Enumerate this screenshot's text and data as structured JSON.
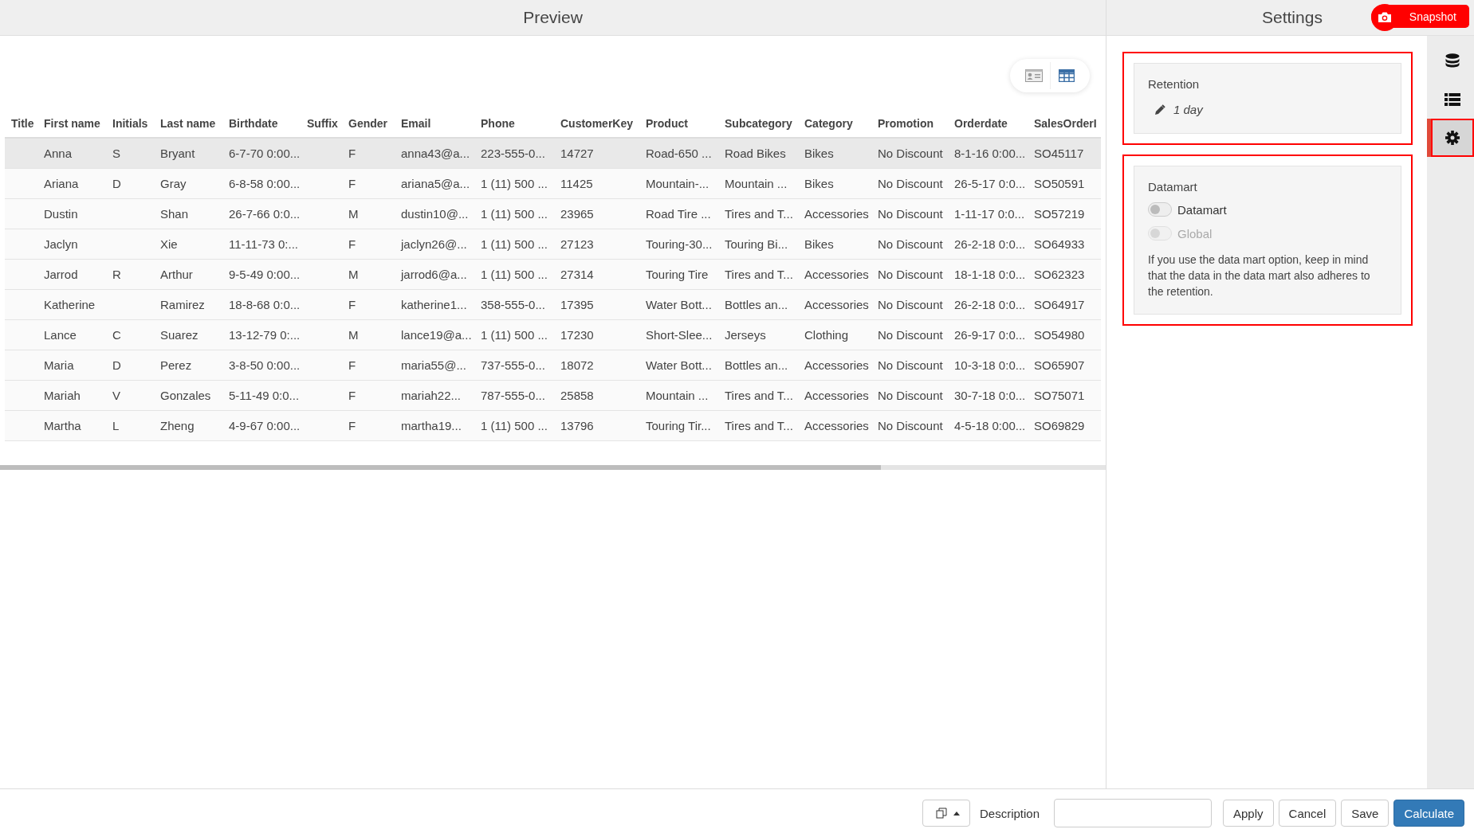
{
  "preview": {
    "title": "Preview",
    "view_toggle": [
      {
        "kind": "card",
        "selected": false
      },
      {
        "kind": "grid",
        "selected": true
      }
    ],
    "table": {
      "columns": [
        "Title",
        "First name",
        "Initials",
        "Last name",
        "Birthdate",
        "Suffix",
        "Gender",
        "Email",
        "Phone",
        "CustomerKey",
        "Product",
        "Subcategory",
        "Category",
        "Promotion",
        "Orderdate",
        "SalesOrderI"
      ],
      "rows": [
        {
          "selected": true,
          "cells": [
            "",
            "Anna",
            "S",
            "Bryant",
            "6-7-70 0:00...",
            "",
            "F",
            "anna43@a...",
            "223-555-0...",
            "14727",
            "Road-650 ...",
            "Road Bikes",
            "Bikes",
            "No Discount",
            "8-1-16 0:00...",
            "SO45117"
          ]
        },
        {
          "selected": false,
          "cells": [
            "",
            "Ariana",
            "D",
            "Gray",
            "6-8-58 0:00...",
            "",
            "F",
            "ariana5@a...",
            "1 (11) 500 ...",
            "11425",
            "Mountain-...",
            "Mountain ...",
            "Bikes",
            "No Discount",
            "26-5-17 0:0...",
            "SO50591"
          ]
        },
        {
          "selected": false,
          "cells": [
            "",
            "Dustin",
            "",
            "Shan",
            "26-7-66 0:0...",
            "",
            "M",
            "dustin10@...",
            "1 (11) 500 ...",
            "23965",
            "Road Tire ...",
            "Tires and T...",
            "Accessories",
            "No Discount",
            "1-11-17 0:0...",
            "SO57219"
          ]
        },
        {
          "selected": false,
          "cells": [
            "",
            "Jaclyn",
            "",
            "Xie",
            "11-11-73 0:...",
            "",
            "F",
            "jaclyn26@...",
            "1 (11) 500 ...",
            "27123",
            "Touring-30...",
            "Touring Bi...",
            "Bikes",
            "No Discount",
            "26-2-18 0:0...",
            "SO64933"
          ]
        },
        {
          "selected": false,
          "cells": [
            "",
            "Jarrod",
            "R",
            "Arthur",
            "9-5-49 0:00...",
            "",
            "M",
            "jarrod6@a...",
            "1 (11) 500 ...",
            "27314",
            "Touring Tire",
            "Tires and T...",
            "Accessories",
            "No Discount",
            "18-1-18 0:0...",
            "SO62323"
          ]
        },
        {
          "selected": false,
          "cells": [
            "",
            "Katherine",
            "",
            "Ramirez",
            "18-8-68 0:0...",
            "",
            "F",
            "katherine1...",
            "358-555-0...",
            "17395",
            "Water Bott...",
            "Bottles an...",
            "Accessories",
            "No Discount",
            "26-2-18 0:0...",
            "SO64917"
          ]
        },
        {
          "selected": false,
          "cells": [
            "",
            "Lance",
            "C",
            "Suarez",
            "13-12-79 0:...",
            "",
            "M",
            "lance19@a...",
            "1 (11) 500 ...",
            "17230",
            "Short-Slee...",
            "Jerseys",
            "Clothing",
            "No Discount",
            "26-9-17 0:0...",
            "SO54980"
          ]
        },
        {
          "selected": false,
          "cells": [
            "",
            "Maria",
            "D",
            "Perez",
            "3-8-50 0:00...",
            "",
            "F",
            "maria55@...",
            "737-555-0...",
            "18072",
            "Water Bott...",
            "Bottles an...",
            "Accessories",
            "No Discount",
            "10-3-18 0:0...",
            "SO65907"
          ]
        },
        {
          "selected": false,
          "cells": [
            "",
            "Mariah",
            "V",
            "Gonzales",
            "5-11-49 0:0...",
            "",
            "F",
            "mariah22...",
            "787-555-0...",
            "25858",
            "Mountain ...",
            "Tires and T...",
            "Accessories",
            "No Discount",
            "30-7-18 0:0...",
            "SO75071"
          ]
        },
        {
          "selected": false,
          "cells": [
            "",
            "Martha",
            "L",
            "Zheng",
            "4-9-67 0:00...",
            "",
            "F",
            "martha19...",
            "1 (11) 500 ...",
            "13796",
            "Touring Tir...",
            "Tires and T...",
            "Accessories",
            "No Discount",
            "4-5-18 0:00...",
            "SO69829"
          ]
        }
      ]
    }
  },
  "settings": {
    "title": "Settings",
    "snapshot_button": "Snapshot",
    "retention": {
      "highlighted": true,
      "title": "Retention",
      "value": "1 day"
    },
    "datamart": {
      "highlighted": true,
      "title": "Datamart",
      "toggles": [
        {
          "label": "Datamart",
          "on": false,
          "disabled": false
        },
        {
          "label": "Global",
          "on": false,
          "disabled": true
        }
      ],
      "note": "If you use the data mart option, keep in mind that the data in the data mart also adheres to the retention."
    }
  },
  "rail": [
    {
      "kind": "database",
      "selected": false,
      "highlighted": false
    },
    {
      "kind": "list",
      "selected": false,
      "highlighted": false
    },
    {
      "kind": "settings",
      "selected": true,
      "highlighted": true
    }
  ],
  "footer": {
    "description_label": "Description",
    "buttons": [
      {
        "label": "Apply",
        "kind": "default"
      },
      {
        "label": "Cancel",
        "kind": "default"
      },
      {
        "label": "Save",
        "kind": "default"
      },
      {
        "label": "Calculate",
        "kind": "primary"
      }
    ]
  }
}
